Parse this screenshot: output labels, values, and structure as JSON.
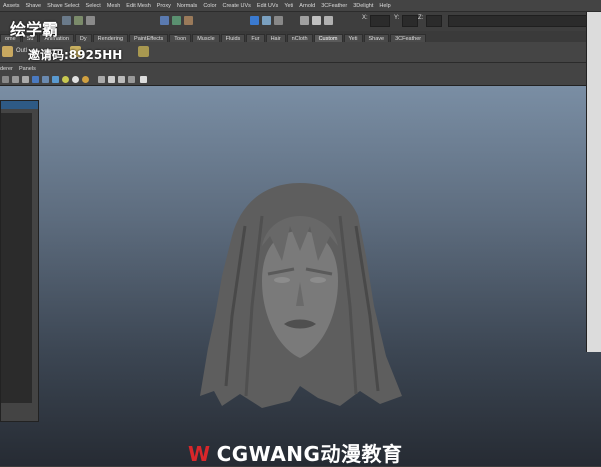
{
  "menu": [
    "Assets",
    "Shave",
    "Shave Select",
    "Select",
    "Mesh",
    "Edit Mesh",
    "Proxy",
    "Normals",
    "Color",
    "Create UVs",
    "Edit UVs",
    "Yeti",
    "Arnold",
    "3CFeather",
    "3Delight",
    "Help"
  ],
  "status": {
    "x_label": "X:",
    "y_label": "Y:",
    "z_label": "Z:"
  },
  "shelf_tabs": [
    "ome",
    "Su",
    "Animation",
    "Dy",
    "Rendering",
    "PaintEffects",
    "Toon",
    "Muscle",
    "Fluids",
    "Fur",
    "Hair",
    "nCloth",
    "Custom",
    "Yeti",
    "Shave",
    "3CFeather"
  ],
  "active_shelf_tab": "Custom",
  "shelf_out_label": "Outl",
  "panel_menu": [
    "derer",
    "Panels"
  ],
  "watermark": {
    "brand": "绘学霸",
    "code": "邀请码:8925HH",
    "bottom_mark": "W",
    "bottom_text": "CGWANG动漫教育"
  },
  "colors": {
    "accent": "#2e5a85",
    "viewport_top": "#7a8ea4",
    "viewport_bottom": "#262b33",
    "mesh": "#6e6e6e"
  },
  "icons": [
    "select-tool-icon",
    "lasso-icon",
    "move-icon",
    "rotate-icon",
    "scale-icon",
    "snap-grid-icon",
    "snap-curve-icon",
    "snap-point-icon",
    "render-icon",
    "ipr-icon",
    "settings-icon",
    "camera-icon",
    "wireframe-icon",
    "smooth-shade-icon",
    "light-icon",
    "xray-icon"
  ]
}
